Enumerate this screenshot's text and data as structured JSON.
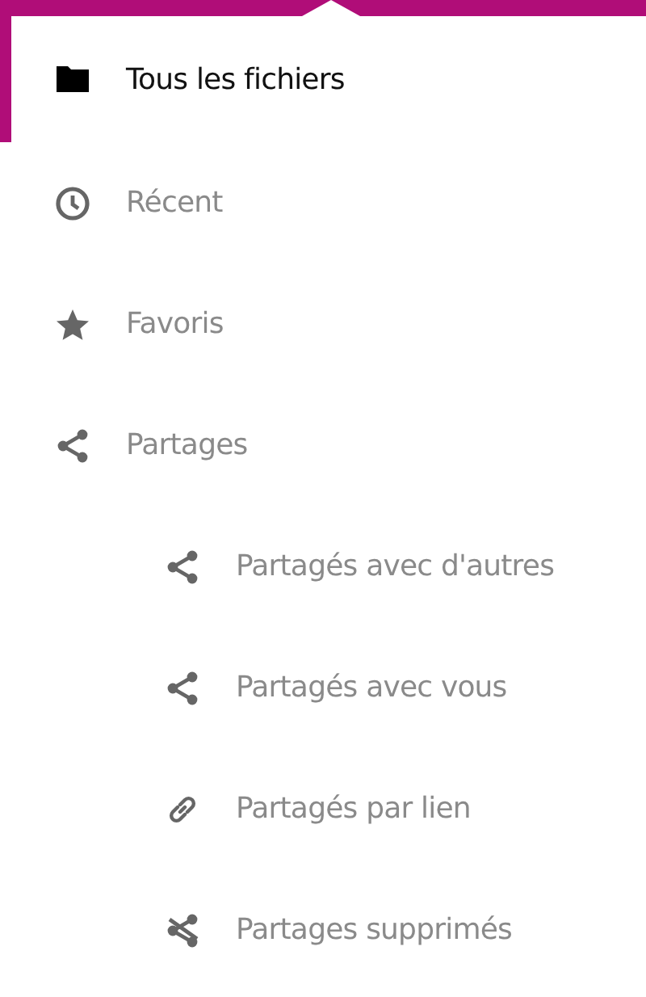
{
  "navigation": [
    {
      "label": "Tous les fichiers",
      "selected": true
    },
    {
      "label": "Récent",
      "selected": false
    },
    {
      "label": "Favoris",
      "selected": false
    },
    {
      "label": "Partages",
      "selected": false,
      "children": [
        {
          "label": "Partagés avec d'autres",
          "selected": false
        },
        {
          "label": "Partagés avec vous",
          "selected": false
        },
        {
          "label": "Partagés par lien",
          "selected": false
        },
        {
          "label": "Partages supprimés",
          "selected": false
        }
      ]
    }
  ]
}
